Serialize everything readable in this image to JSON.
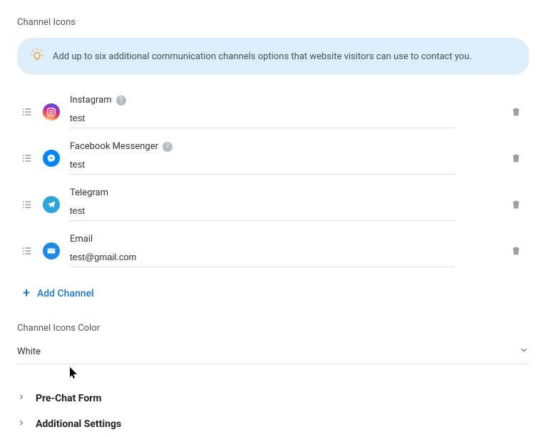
{
  "section": {
    "title": "Channel Icons"
  },
  "banner": {
    "text": "Add up to six additional communication channels options that website visitors can use to contact you."
  },
  "channels": [
    {
      "label": "Instagram",
      "value": "test",
      "help": true,
      "brand": "instagram"
    },
    {
      "label": "Facebook Messenger",
      "value": "test",
      "help": true,
      "brand": "messenger"
    },
    {
      "label": "Telegram",
      "value": "test",
      "help": false,
      "brand": "telegram"
    },
    {
      "label": "Email",
      "value": "test@gmail.com",
      "help": false,
      "brand": "email"
    }
  ],
  "add_channel_label": "Add Channel",
  "color": {
    "label": "Channel Icons Color",
    "value": "White"
  },
  "accordion": [
    {
      "label": "Pre-Chat Form"
    },
    {
      "label": "Additional Settings"
    }
  ]
}
